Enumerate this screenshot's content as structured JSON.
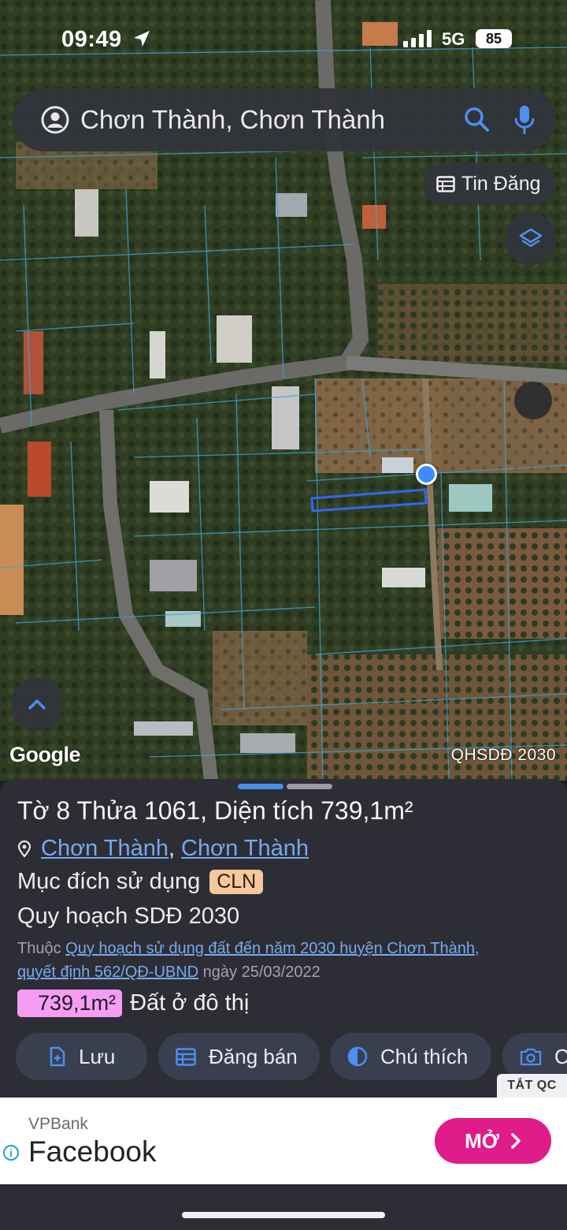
{
  "status_bar": {
    "time": "09:49",
    "network": "5G",
    "battery": "85"
  },
  "search": {
    "query": "Chơn Thành, Chơn Thành"
  },
  "map": {
    "listing_chip_label": "Tin Đăng",
    "google_logo": "Google",
    "plan_layer_label": "QHSDĐ 2030"
  },
  "parcel": {
    "title": "Tờ 8 Thửa 1061, Diện tích 739,1m²",
    "address_parts": [
      "Chơn Thành",
      "Chơn Thành"
    ],
    "address_separator": ",",
    "purpose_label": "Mục đích sử dụng",
    "purpose_code": "CLN",
    "plan_title": "Quy hoạch SDĐ 2030",
    "belongs_prefix": "Thuộc",
    "belongs_link1": "Quy hoạch sử dụng đất đến năm 2030 huyện Chơn Thành,",
    "belongs_link2": "quyết định 562/QĐ-UBND",
    "belongs_suffix": "ngày 25/03/2022",
    "area_value": "739,1m²",
    "area_label": "Đất ở đô thị"
  },
  "actions": [
    {
      "label": "Lưu",
      "icon": "save-file-icon"
    },
    {
      "label": "Đăng bán",
      "icon": "calendar-grid-icon"
    },
    {
      "label": "Chú thích",
      "icon": "half-circle-icon"
    },
    {
      "label": "C",
      "icon": "camera-icon"
    }
  ],
  "ad": {
    "close_label": "TẮT QC",
    "advertiser": "VPBank",
    "headline": "Facebook",
    "cta_label": "MỞ"
  },
  "colors": {
    "accent_blue": "#4a8fe7",
    "link_blue": "#78a9ee",
    "purpose_badge": "#f4c79d",
    "area_badge": "#f59cf5",
    "cta_pink": "#e01c8a",
    "sheet_bg": "#2d2e35"
  }
}
